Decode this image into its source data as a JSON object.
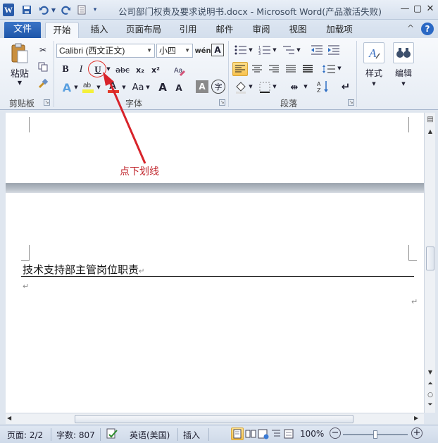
{
  "titlebar": {
    "app_logo": "W",
    "title": "公司部门权责及要求说明书.docx - Microsoft Word(产品激活失败)",
    "icons": [
      "word-logo",
      "save-icon",
      "undo-icon",
      "redo-icon",
      "print-preview-icon",
      "qat-dropdown-icon"
    ]
  },
  "tabs": {
    "file": "文件",
    "items": [
      "开始",
      "插入",
      "页面布局",
      "引用",
      "邮件",
      "审阅",
      "视图",
      "加载项"
    ],
    "active": "开始"
  },
  "ribbon": {
    "clipboard": {
      "paste": "粘贴",
      "label": "剪贴板"
    },
    "font": {
      "font_name": "Calibri (西文正文)",
      "font_size": "小四",
      "label": "字体",
      "bold": "B",
      "italic": "I",
      "underline": "U",
      "strike": "abc",
      "subscript": "x₂",
      "superscript": "x²",
      "case": "Aa",
      "grow": "A",
      "shrink": "A"
    },
    "paragraph": {
      "label": "段落"
    },
    "styles": {
      "label": "样式"
    },
    "editing": {
      "label": "编辑"
    }
  },
  "document": {
    "annotation": "点下划线",
    "heading": "技术支持部主管岗位职责",
    "paragraph_mark": "↵"
  },
  "statusbar": {
    "page": "页面: 2/2",
    "words": "字数: 807",
    "language": "英语(美国)",
    "mode": "插入",
    "zoom": "100%"
  },
  "colors": {
    "file_tab": "#1e56a9",
    "annotation": "#c0262d",
    "highlight": "#f8c24d"
  }
}
